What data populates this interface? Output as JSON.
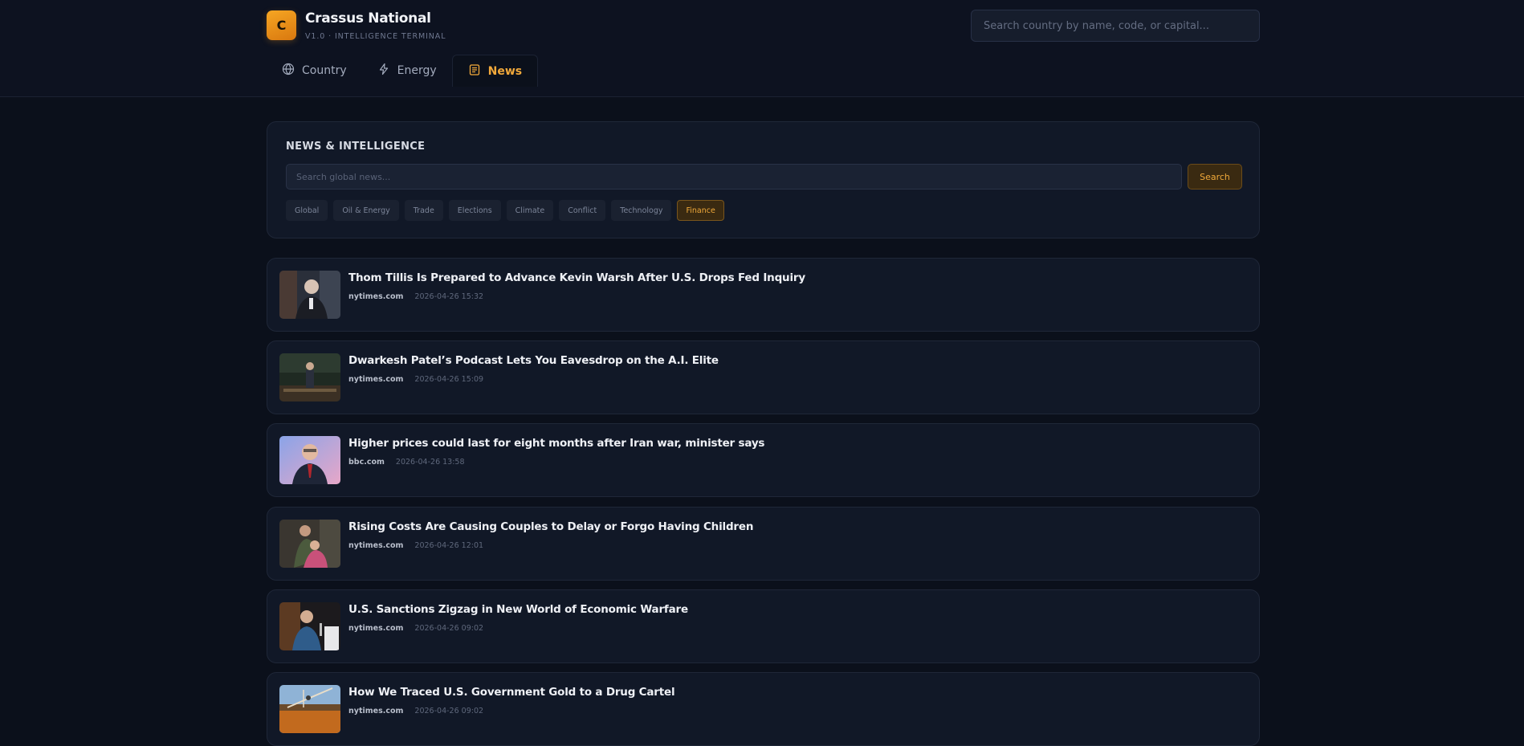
{
  "header": {
    "logo_letter": "C",
    "app_title": "Crassus National",
    "app_subtitle": "V1.0 · INTELLIGENCE TERMINAL",
    "search_placeholder": "Search country by name, code, or capital..."
  },
  "tabs": [
    {
      "label": "Country",
      "icon": "globe-icon",
      "active": false
    },
    {
      "label": "Energy",
      "icon": "lightning-icon",
      "active": false
    },
    {
      "label": "News",
      "icon": "newspaper-icon",
      "active": true
    }
  ],
  "news_panel": {
    "title": "NEWS & INTELLIGENCE",
    "search_placeholder": "Search global news...",
    "search_button": "Search",
    "filters": [
      {
        "label": "Global",
        "active": false
      },
      {
        "label": "Oil & Energy",
        "active": false
      },
      {
        "label": "Trade",
        "active": false
      },
      {
        "label": "Elections",
        "active": false
      },
      {
        "label": "Climate",
        "active": false
      },
      {
        "label": "Conflict",
        "active": false
      },
      {
        "label": "Technology",
        "active": false
      },
      {
        "label": "Finance",
        "active": true
      }
    ]
  },
  "articles": [
    {
      "title": "Thom Tillis Is Prepared to Advance Kevin Warsh After U.S. Drops Fed Inquiry",
      "source": "nytimes.com",
      "time": "2026-04-26 15:32"
    },
    {
      "title": "Dwarkesh Patel’s Podcast Lets You Eavesdrop on the A.I. Elite",
      "source": "nytimes.com",
      "time": "2026-04-26 15:09"
    },
    {
      "title": "Higher prices could last for eight months after Iran war, minister says",
      "source": "bbc.com",
      "time": "2026-04-26 13:58"
    },
    {
      "title": "Rising Costs Are Causing Couples to Delay or Forgo Having Children",
      "source": "nytimes.com",
      "time": "2026-04-26 12:01"
    },
    {
      "title": "U.S. Sanctions Zigzag in New World of Economic Warfare",
      "source": "nytimes.com",
      "time": "2026-04-26 09:02"
    },
    {
      "title": "How We Traced U.S. Government Gold to a Drug Cartel",
      "source": "nytimes.com",
      "time": "2026-04-26 09:02"
    }
  ],
  "colors": {
    "accent": "#f0a93a",
    "background": "#0b101b",
    "card": "#111827"
  }
}
